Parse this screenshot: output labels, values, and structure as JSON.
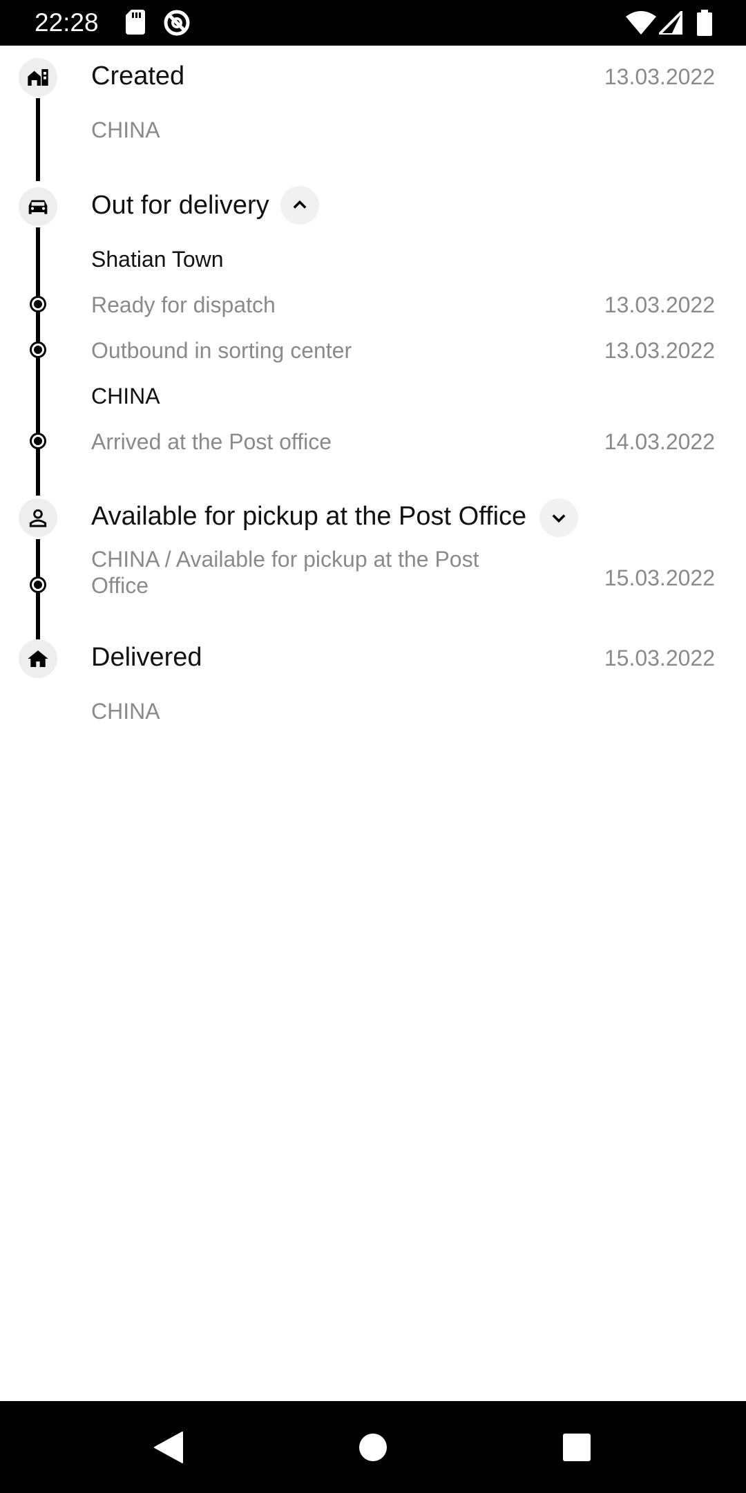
{
  "status_bar": {
    "time": "22:28",
    "icons": [
      "sd-card-icon",
      "at-sign-icon",
      "wifi-icon",
      "signal-icon",
      "battery-icon"
    ]
  },
  "timeline": {
    "created": {
      "title": "Created",
      "date": "13.03.2022",
      "location": "CHINA",
      "icon": "warehouse-icon"
    },
    "out_for_delivery": {
      "title": "Out for delivery",
      "icon": "car-icon",
      "toggle_icon": "chevron-up-icon",
      "group1_location": "Shatian Town",
      "event1": {
        "text": "Ready for dispatch",
        "date": "13.03.2022"
      },
      "event2": {
        "text": "Outbound in sorting center",
        "date": "13.03.2022"
      },
      "group2_location": "CHINA",
      "event3": {
        "text": "Arrived at the Post office",
        "date": "14.03.2022"
      }
    },
    "pickup": {
      "title": "Available for pickup at the Post Office",
      "icon": "person-icon",
      "toggle_icon": "chevron-down-icon",
      "event": {
        "text": "CHINA / Available for pickup at the Post Office",
        "date": "15.03.2022"
      }
    },
    "delivered": {
      "title": "Delivered",
      "date": "15.03.2022",
      "location": "CHINA",
      "icon": "home-icon"
    }
  },
  "nav_bar": {
    "buttons": [
      "back-button",
      "home-button",
      "recents-button"
    ]
  }
}
